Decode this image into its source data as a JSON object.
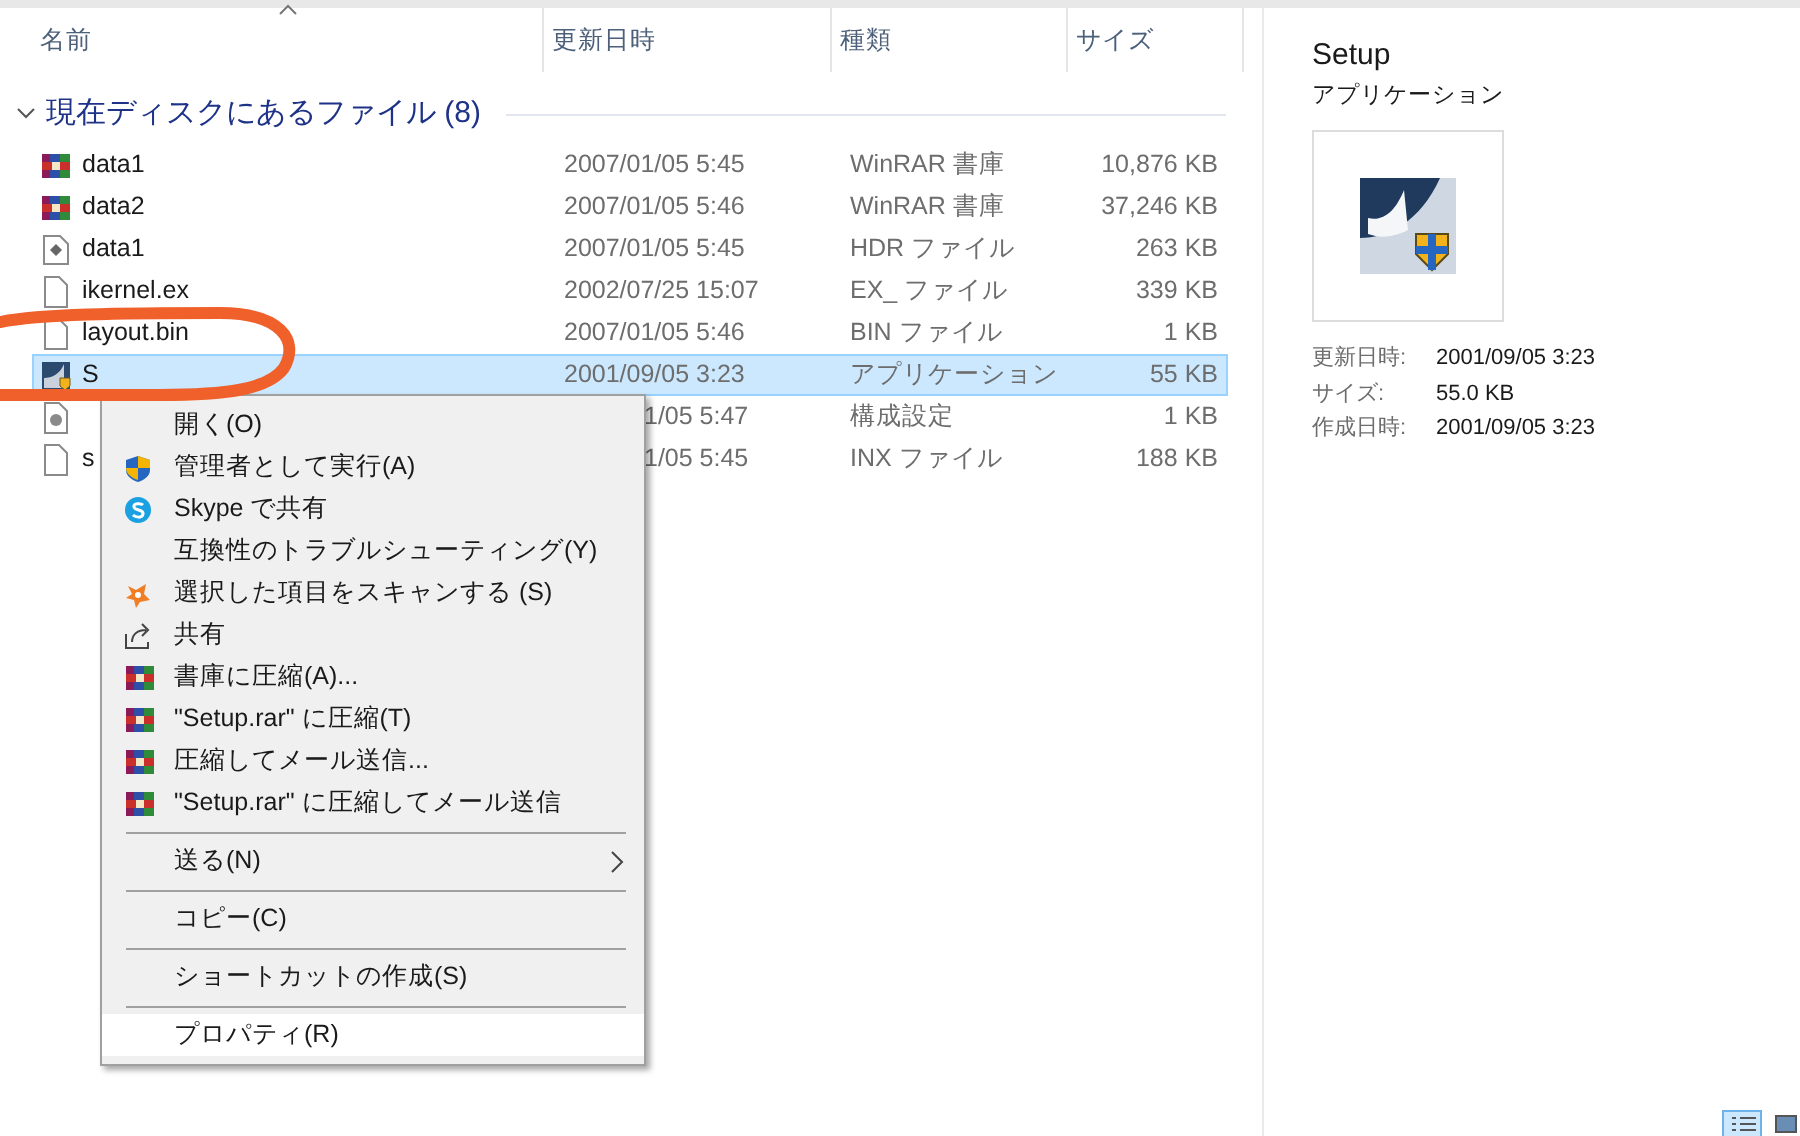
{
  "columns": [
    {
      "label": "名前",
      "sorted": true
    },
    {
      "label": "更新日時",
      "sorted": false
    },
    {
      "label": "種類",
      "sorted": false
    },
    {
      "label": "サイズ",
      "sorted": false
    }
  ],
  "group": {
    "label": "現在ディスクにあるファイル (8)",
    "expanded": true
  },
  "files": [
    {
      "kind": "archive",
      "name": "data1",
      "modified": "2007/01/05 5:45",
      "type": "WinRAR 書庫",
      "size": "10,876 KB",
      "selected": false,
      "covered": false
    },
    {
      "kind": "archive",
      "name": "data2",
      "modified": "2007/01/05 5:46",
      "type": "WinRAR 書庫",
      "size": "37,246 KB",
      "selected": false,
      "covered": false
    },
    {
      "kind": "document",
      "name": "data1",
      "modified": "2007/01/05 5:45",
      "type": "HDR ファイル",
      "size": "263 KB",
      "selected": false,
      "covered": false
    },
    {
      "kind": "blank",
      "name": "ikernel.ex",
      "modified": "2002/07/25 15:07",
      "type": "EX_ ファイル",
      "size": "339 KB",
      "selected": false,
      "covered": false
    },
    {
      "kind": "blank",
      "name": "layout.bin",
      "modified": "2007/01/05 5:46",
      "type": "BIN ファイル",
      "size": "1 KB",
      "selected": false,
      "covered": false
    },
    {
      "kind": "application",
      "name": "S",
      "modified": "2001/09/05 3:23",
      "type": "アプリケーション",
      "size": "55 KB",
      "selected": true,
      "covered": false
    },
    {
      "kind": "settings",
      "modified": "1/05 5:47",
      "type": "構成設定",
      "size": "1 KB",
      "selected": false,
      "covered": true
    },
    {
      "kind": "blank",
      "name": "s",
      "modified": "1/05 5:45",
      "type": "INX ファイル",
      "size": "188 KB",
      "selected": false,
      "covered": true
    }
  ],
  "context_menu": [
    {
      "kind": "item",
      "label": "開く(O)",
      "selected": false
    },
    {
      "kind": "item",
      "label": "管理者として実行(A)",
      "selected": false
    },
    {
      "kind": "item",
      "label": "Skype で共有",
      "selected": false
    },
    {
      "kind": "item",
      "label": "互換性のトラブルシューティング(Y)",
      "selected": false
    },
    {
      "kind": "item",
      "label": "選択した項目をスキャンする (S)",
      "selected": false
    },
    {
      "kind": "item",
      "label": "共有",
      "selected": false
    },
    {
      "kind": "item",
      "label": "書庫に圧縮(A)...",
      "selected": false
    },
    {
      "kind": "item",
      "label": "\"Setup.rar\" に圧縮(T)",
      "selected": false
    },
    {
      "kind": "item",
      "label": "圧縮してメール送信...",
      "selected": false
    },
    {
      "kind": "item",
      "label": "\"Setup.rar\" に圧縮してメール送信",
      "selected": false
    },
    {
      "kind": "separator"
    },
    {
      "kind": "submenu",
      "label": "送る(N)",
      "selected": false
    },
    {
      "kind": "separator"
    },
    {
      "kind": "item",
      "label": "コピー(C)",
      "selected": false
    },
    {
      "kind": "separator"
    },
    {
      "kind": "item",
      "label": "ショートカットの作成(S)",
      "selected": false
    },
    {
      "kind": "separator"
    },
    {
      "kind": "item",
      "label": "プロパティ(R)",
      "selected": true
    }
  ],
  "details_pane": {
    "title": "Setup",
    "subtitle": "アプリケーション",
    "properties": [
      {
        "label": "更新日時:",
        "value": "2001/09/05 3:23"
      },
      {
        "label": "サイズ:",
        "value": "55.0 KB"
      },
      {
        "label": "作成日時:",
        "value": "2001/09/05 3:23"
      }
    ]
  },
  "view_buttons": [
    {
      "kind": "details",
      "selected": true
    },
    {
      "kind": "large_icons",
      "selected": false
    }
  ]
}
